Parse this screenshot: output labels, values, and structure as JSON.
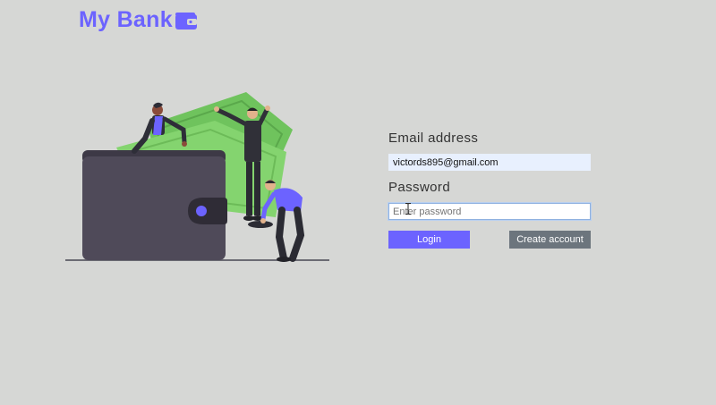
{
  "header": {
    "brand": "My Bank",
    "brand_icon": "wallet-icon",
    "brand_color": "#6c63ff"
  },
  "illustration": {
    "description_icon": "people-with-money-and-wallet-illustration"
  },
  "login_form": {
    "email_label": "Email address",
    "email_value": "victords895@gmail.com",
    "password_label": "Password",
    "password_placeholder": "Enter password",
    "login_label": "Login",
    "create_account_label": "Create account"
  },
  "colors": {
    "background": "#d6d7d5",
    "accent": "#6c63ff",
    "secondary_button": "#6c757d",
    "money_green": "#7fd06a",
    "wallet_dark": "#4f4a59"
  }
}
